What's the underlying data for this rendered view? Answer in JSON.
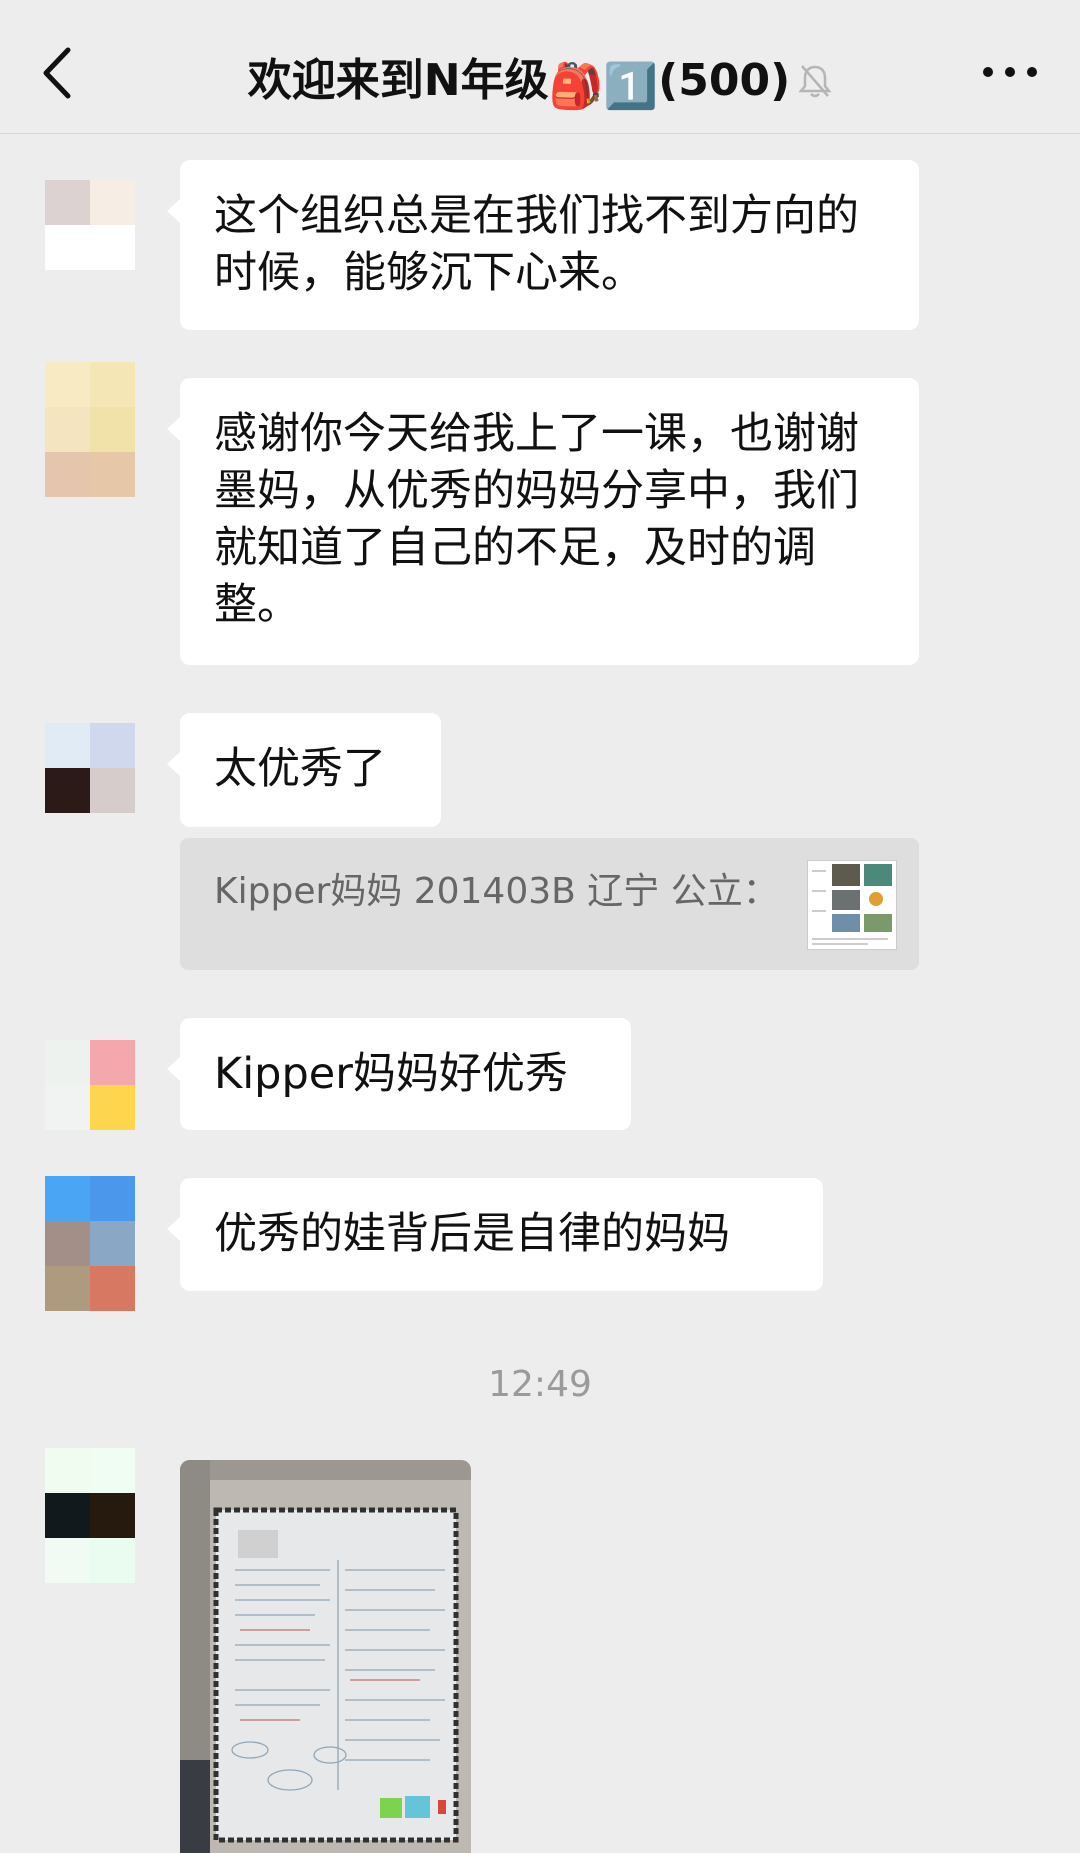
{
  "header": {
    "title": "欢迎来到N年级",
    "emoji_backpack": "🎒",
    "emoji_one": "1️⃣",
    "member_count": "(500)"
  },
  "messages": [
    {
      "text": "这个组织总是在我们找不到方向的时候，能够沉下心来。"
    },
    {
      "text": "感谢你今天给我上了一课，也谢谢墨妈，从优秀的妈妈分享中，我们就知道了自己的不足，及时的调整。"
    },
    {
      "text": "太优秀了"
    },
    {
      "text": "Kipper妈妈好优秀"
    },
    {
      "text": "优秀的娃背后是自律的妈妈"
    }
  ],
  "quote": {
    "text": "Kipper妈妈 201403B 辽宁 公立："
  },
  "timestamp": "12:49",
  "avatars": [
    [
      "#dcd2d2",
      "#f6eee4",
      "#ffffff",
      "#ffffff"
    ],
    [
      "#f8ebc4",
      "#f4e7b5",
      "#f4e5c0",
      "#f0e2a8",
      "#e5c6ad",
      "#e6c8a9"
    ],
    [
      "#e1ebf5",
      "#cfd8ec",
      "#2b1a17",
      "#d6cccc"
    ],
    [
      "#eef2ef",
      "#f4a7ac",
      "#f1f3f2",
      "#fdd64d"
    ],
    [
      "#4aa6f5",
      "#4b97ec",
      "#a29088",
      "#8aa8c5",
      "#ae9a7e",
      "#d77962"
    ],
    [
      "#f0fcf0",
      "#f0fdf2",
      "#11191c",
      "#261a0f",
      "#f2fbf3",
      "#eafbf0"
    ]
  ]
}
